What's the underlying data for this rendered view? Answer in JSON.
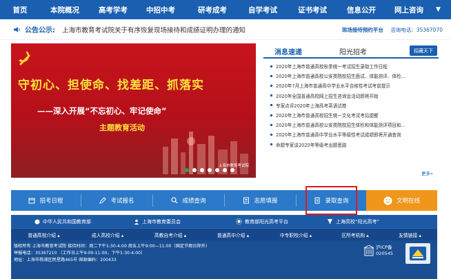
{
  "nav": {
    "items": [
      "首页",
      "本院概况",
      "高考学考",
      "中招中考",
      "研考成考",
      "自学考试",
      "证书考试",
      "信息公开",
      "网上咨询"
    ],
    "dropdown_arrow": "▼"
  },
  "notice": {
    "label": "公告公示:",
    "text": "上海市教育考试院关于有序恢复现场接待和成绩证明办理的通知",
    "right_link": "现场接待预约平台",
    "phone": "咨询电话：35367070"
  },
  "banner": {
    "slogan1": "守初心、担使命、找差距、抓落实",
    "slogan2": "——深入开展“不忘初心、牢记使命”",
    "slogan3": "主题教育活动",
    "caption": "上海市教育考试院",
    "dot_count": 7,
    "active_dot": 0
  },
  "news": {
    "tab_active": "消息速递",
    "tab_other": "阳光招考",
    "more_button": "招藏天下",
    "items": [
      "2020年上海市普通高校秋季统一考试招生录取工作日程",
      "2020年上海市普通高校公安类院校招生面试、体能测评、体检...",
      "2020年7月上海市普通高中学业水平合格性考试考前提示",
      "2020年全国普通高校网上招生咨询会活动即将开始",
      "专家点评2020年上海高考英语试卷",
      "2020年上海市普通高校招生统一文化考试考后提醒",
      "2020年上海市普通高校公安类院校招生体检和体能测评项目和...",
      "2020年上海市普通高中学业水平等级性考试成绩即将开通查询",
      "命题专家谈2020年等级考出题思路"
    ],
    "more_link": "更多»"
  },
  "services": [
    {
      "label": "招考日程",
      "icon": "calendar-icon"
    },
    {
      "label": "考试报名",
      "icon": "pencil-icon"
    },
    {
      "label": "成绩查询",
      "icon": "search-icon"
    },
    {
      "label": "志愿填报",
      "icon": "form-icon"
    },
    {
      "label": "录取查询",
      "icon": "document-icon"
    },
    {
      "label": "文明在线",
      "icon": "smile-icon"
    }
  ],
  "footer": {
    "links": [
      {
        "label": "中华人民共和国教育部",
        "icon": "gov-icon"
      },
      {
        "label": "上海市教育委员会",
        "icon": "people-icon"
      },
      {
        "label": "教育部阳光高考平台",
        "icon": "sun-icon"
      },
      {
        "label": "上海高校“阳光高考”",
        "icon": "trophy-icon"
      }
    ],
    "categories": [
      "普通高校介绍 ▴",
      "成人高校介绍 ▴",
      "高教自考介绍 ▴",
      "普通高中介绍 ▴",
      "中专职校介绍 ▴",
      "区所考机构 ▴",
      "友情链接 ▴"
    ],
    "info_lines": [
      "版权所有  上海市教育考试院  接待时间：周二下午1:30-4:00  周五上午9:00—11:00（国定节假日除外）",
      "举报电话：35367210  （工作日上午9:00-11:00，下午1:30-4:00）",
      "地址：上海市杨浦区民星路465号 邮政编码：200433"
    ],
    "icp": [
      "沪ICP备",
      "020545"
    ],
    "colors": {
      "primary": "#1a5fb0",
      "accent": "#f0961a",
      "banner_red": "#c8141c",
      "highlight": "#e0191c"
    }
  }
}
